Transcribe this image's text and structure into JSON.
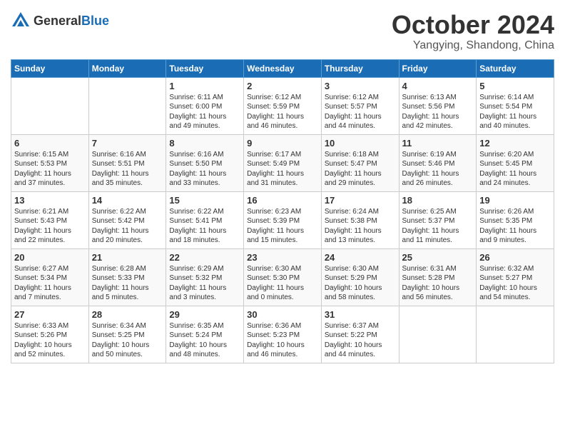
{
  "header": {
    "logo_general": "General",
    "logo_blue": "Blue",
    "month": "October 2024",
    "location": "Yangying, Shandong, China"
  },
  "days_of_week": [
    "Sunday",
    "Monday",
    "Tuesday",
    "Wednesday",
    "Thursday",
    "Friday",
    "Saturday"
  ],
  "weeks": [
    [
      {
        "day": "",
        "content": ""
      },
      {
        "day": "",
        "content": ""
      },
      {
        "day": "1",
        "content": "Sunrise: 6:11 AM\nSunset: 6:00 PM\nDaylight: 11 hours\nand 49 minutes."
      },
      {
        "day": "2",
        "content": "Sunrise: 6:12 AM\nSunset: 5:59 PM\nDaylight: 11 hours\nand 46 minutes."
      },
      {
        "day": "3",
        "content": "Sunrise: 6:12 AM\nSunset: 5:57 PM\nDaylight: 11 hours\nand 44 minutes."
      },
      {
        "day": "4",
        "content": "Sunrise: 6:13 AM\nSunset: 5:56 PM\nDaylight: 11 hours\nand 42 minutes."
      },
      {
        "day": "5",
        "content": "Sunrise: 6:14 AM\nSunset: 5:54 PM\nDaylight: 11 hours\nand 40 minutes."
      }
    ],
    [
      {
        "day": "6",
        "content": "Sunrise: 6:15 AM\nSunset: 5:53 PM\nDaylight: 11 hours\nand 37 minutes."
      },
      {
        "day": "7",
        "content": "Sunrise: 6:16 AM\nSunset: 5:51 PM\nDaylight: 11 hours\nand 35 minutes."
      },
      {
        "day": "8",
        "content": "Sunrise: 6:16 AM\nSunset: 5:50 PM\nDaylight: 11 hours\nand 33 minutes."
      },
      {
        "day": "9",
        "content": "Sunrise: 6:17 AM\nSunset: 5:49 PM\nDaylight: 11 hours\nand 31 minutes."
      },
      {
        "day": "10",
        "content": "Sunrise: 6:18 AM\nSunset: 5:47 PM\nDaylight: 11 hours\nand 29 minutes."
      },
      {
        "day": "11",
        "content": "Sunrise: 6:19 AM\nSunset: 5:46 PM\nDaylight: 11 hours\nand 26 minutes."
      },
      {
        "day": "12",
        "content": "Sunrise: 6:20 AM\nSunset: 5:45 PM\nDaylight: 11 hours\nand 24 minutes."
      }
    ],
    [
      {
        "day": "13",
        "content": "Sunrise: 6:21 AM\nSunset: 5:43 PM\nDaylight: 11 hours\nand 22 minutes."
      },
      {
        "day": "14",
        "content": "Sunrise: 6:22 AM\nSunset: 5:42 PM\nDaylight: 11 hours\nand 20 minutes."
      },
      {
        "day": "15",
        "content": "Sunrise: 6:22 AM\nSunset: 5:41 PM\nDaylight: 11 hours\nand 18 minutes."
      },
      {
        "day": "16",
        "content": "Sunrise: 6:23 AM\nSunset: 5:39 PM\nDaylight: 11 hours\nand 15 minutes."
      },
      {
        "day": "17",
        "content": "Sunrise: 6:24 AM\nSunset: 5:38 PM\nDaylight: 11 hours\nand 13 minutes."
      },
      {
        "day": "18",
        "content": "Sunrise: 6:25 AM\nSunset: 5:37 PM\nDaylight: 11 hours\nand 11 minutes."
      },
      {
        "day": "19",
        "content": "Sunrise: 6:26 AM\nSunset: 5:35 PM\nDaylight: 11 hours\nand 9 minutes."
      }
    ],
    [
      {
        "day": "20",
        "content": "Sunrise: 6:27 AM\nSunset: 5:34 PM\nDaylight: 11 hours\nand 7 minutes."
      },
      {
        "day": "21",
        "content": "Sunrise: 6:28 AM\nSunset: 5:33 PM\nDaylight: 11 hours\nand 5 minutes."
      },
      {
        "day": "22",
        "content": "Sunrise: 6:29 AM\nSunset: 5:32 PM\nDaylight: 11 hours\nand 3 minutes."
      },
      {
        "day": "23",
        "content": "Sunrise: 6:30 AM\nSunset: 5:30 PM\nDaylight: 11 hours\nand 0 minutes."
      },
      {
        "day": "24",
        "content": "Sunrise: 6:30 AM\nSunset: 5:29 PM\nDaylight: 10 hours\nand 58 minutes."
      },
      {
        "day": "25",
        "content": "Sunrise: 6:31 AM\nSunset: 5:28 PM\nDaylight: 10 hours\nand 56 minutes."
      },
      {
        "day": "26",
        "content": "Sunrise: 6:32 AM\nSunset: 5:27 PM\nDaylight: 10 hours\nand 54 minutes."
      }
    ],
    [
      {
        "day": "27",
        "content": "Sunrise: 6:33 AM\nSunset: 5:26 PM\nDaylight: 10 hours\nand 52 minutes."
      },
      {
        "day": "28",
        "content": "Sunrise: 6:34 AM\nSunset: 5:25 PM\nDaylight: 10 hours\nand 50 minutes."
      },
      {
        "day": "29",
        "content": "Sunrise: 6:35 AM\nSunset: 5:24 PM\nDaylight: 10 hours\nand 48 minutes."
      },
      {
        "day": "30",
        "content": "Sunrise: 6:36 AM\nSunset: 5:23 PM\nDaylight: 10 hours\nand 46 minutes."
      },
      {
        "day": "31",
        "content": "Sunrise: 6:37 AM\nSunset: 5:22 PM\nDaylight: 10 hours\nand 44 minutes."
      },
      {
        "day": "",
        "content": ""
      },
      {
        "day": "",
        "content": ""
      }
    ]
  ]
}
